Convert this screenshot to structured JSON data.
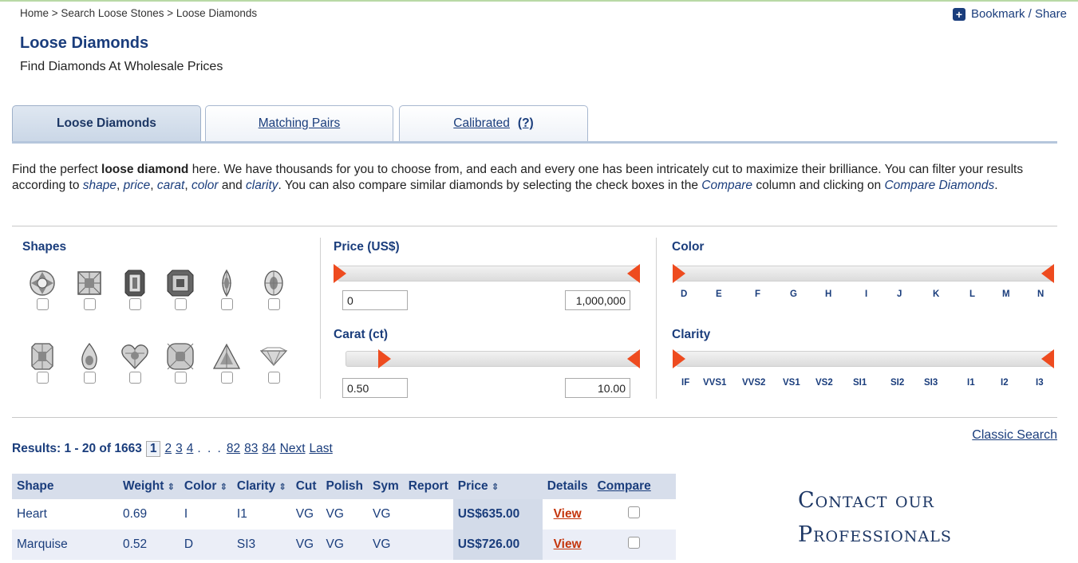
{
  "breadcrumb": "Home > Search Loose Stones > Loose Diamonds",
  "bookmark": {
    "icon": "plus-icon",
    "label": "Bookmark / Share"
  },
  "header": {
    "title": "Loose Diamonds",
    "subtitle": "Find Diamonds At Wholesale Prices"
  },
  "tabs": [
    {
      "label": "Loose Diamonds",
      "active": true
    },
    {
      "label": "Matching Pairs",
      "active": false
    },
    {
      "label": "Calibrated",
      "help": "(?)",
      "active": false
    }
  ],
  "intro": {
    "p1": "Find the perfect ",
    "b1": "loose diamond",
    "p2": " here. We have thousands for you to choose from, and each and every one has been intricately cut to maximize their brilliance. You can filter your results according to ",
    "i1": "shape",
    "p3": ", ",
    "i2": "price",
    "p4": ", ",
    "i3": "carat",
    "p5": ", ",
    "i4": "color",
    "p6": " and ",
    "i5": "clarity",
    "p7": ". You can also compare similar diamonds by selecting the check boxes in the ",
    "i6": "Compare",
    "p8": " column and clicking on ",
    "i7": "Compare Diamonds",
    "p9": "."
  },
  "filters": {
    "shapes_label": "Shapes",
    "shapes": [
      "round-icon",
      "princess-icon",
      "emerald-icon",
      "asscher-icon",
      "marquise-icon",
      "oval-icon",
      "radiant-icon",
      "pear-icon",
      "heart-icon",
      "cushion-icon",
      "trilliant-icon",
      "trillion-side-icon"
    ],
    "price_label": "Price (US$)",
    "price_min": "0",
    "price_max": "1,000,000",
    "carat_label": "Carat (ct)",
    "carat_min": "0.50",
    "carat_max": "10.00",
    "color_label": "Color",
    "color_scale": [
      "D",
      "E",
      "F",
      "G",
      "H",
      "I",
      "J",
      "K",
      "L",
      "M",
      "N"
    ],
    "clarity_label": "Clarity",
    "clarity_scale": [
      "IF",
      "VVS1",
      "VVS2",
      "VS1",
      "VS2",
      "SI1",
      "SI2",
      "SI3",
      "I1",
      "I2",
      "I3"
    ],
    "accent_color": "#ee4b1f"
  },
  "results": {
    "summary": "Results: 1 - 20 of 1663",
    "pages": [
      "1",
      "2",
      "3",
      "4"
    ],
    "current_page": "1",
    "ellipsis": ". . .",
    "last_pages": [
      "82",
      "83",
      "84"
    ],
    "next": "Next",
    "last": "Last",
    "classic_search": "Classic Search"
  },
  "table": {
    "headers": [
      "Shape",
      "Weight",
      "Color",
      "Clarity",
      "Cut",
      "Polish",
      "Sym",
      "Report",
      "Price",
      "Details",
      "Compare"
    ],
    "sort_glyph": "⇕",
    "rows": [
      {
        "shape": "Heart",
        "weight": "0.69",
        "color": "I",
        "clarity": "I1",
        "cut": "VG",
        "polish": "VG",
        "sym": "VG",
        "report": "",
        "price": "US$635.00",
        "details": "View"
      },
      {
        "shape": "Marquise",
        "weight": "0.52",
        "color": "D",
        "clarity": "SI3",
        "cut": "VG",
        "polish": "VG",
        "sym": "VG",
        "report": "",
        "price": "US$726.00",
        "details": "View"
      }
    ]
  },
  "contact": {
    "line1": "Contact our",
    "line2": "Professionals"
  }
}
